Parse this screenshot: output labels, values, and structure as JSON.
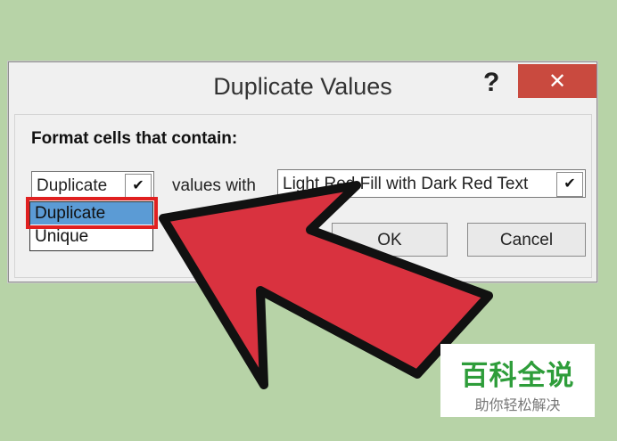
{
  "dialog": {
    "title": "Duplicate Values",
    "help_icon": "?",
    "close_icon": "✕",
    "heading": "Format cells that contain:",
    "type_select_value": "Duplicate",
    "values_with_label": "values with",
    "format_select_value": "Light Red Fill with Dark Red Text",
    "dropdown_options": [
      "Duplicate",
      "Unique"
    ],
    "ok_label": "OK",
    "cancel_label": "Cancel"
  },
  "logo": {
    "main": "百科全说",
    "sub": "助你轻松解决"
  },
  "colors": {
    "background": "#b7d3a7",
    "close_button": "#c94a3f",
    "selection": "#5b9bd5",
    "highlight_box": "#e02020",
    "arrow_fill": "#d9323f",
    "logo_green": "#2e9d3a"
  },
  "icons": {
    "dropdown_arrow": "chevron-down-icon",
    "pointer": "big-red-arrow-icon"
  }
}
